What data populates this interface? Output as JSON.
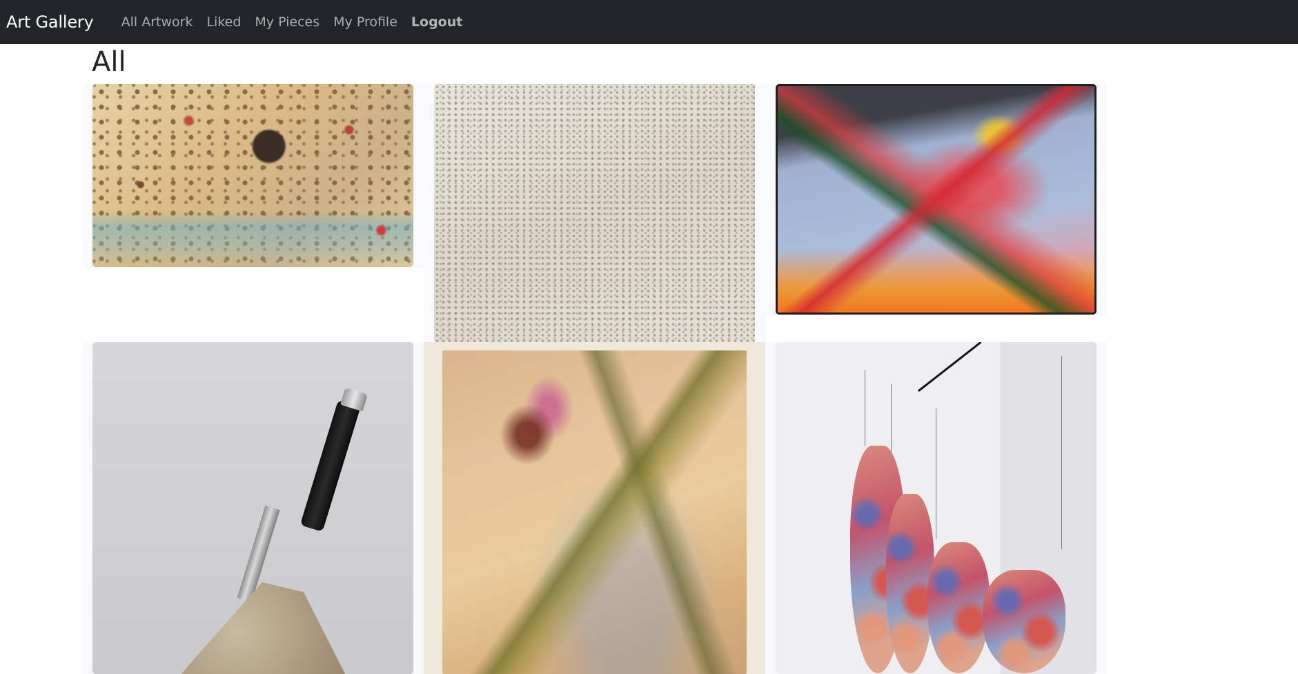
{
  "navbar": {
    "brand": "Art Gallery",
    "links": [
      "All Artwork",
      "Liked",
      "My Pieces",
      "My Profile"
    ],
    "logout": "Logout"
  },
  "page": {
    "title": "All"
  },
  "gallery": {
    "artworks": [
      {
        "label": "artwork-collage-dots"
      },
      {
        "label": "artwork-infinity-net"
      },
      {
        "label": "artwork-abstract-explosion"
      },
      {
        "label": "artwork-knife-on-rock"
      },
      {
        "label": "artwork-stained-canvas"
      },
      {
        "label": "artwork-hanging-canvases"
      }
    ]
  },
  "colors": {
    "navbar_bg": "#212529",
    "card_bg": "#f8f9fa",
    "text": "#212529"
  }
}
